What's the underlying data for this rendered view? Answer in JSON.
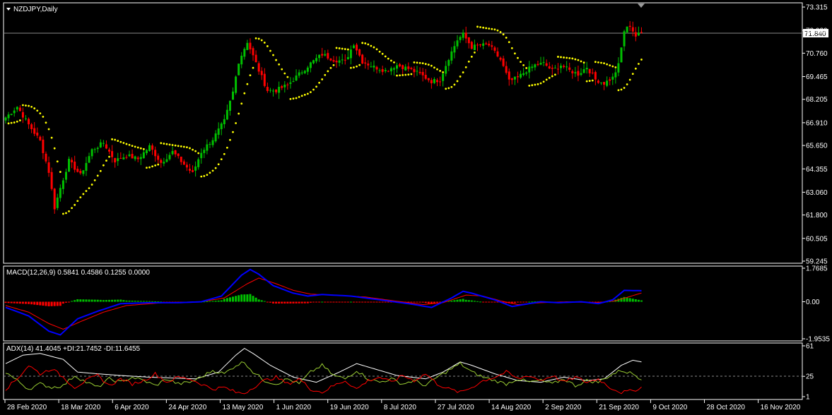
{
  "symbol_title": "NZDJPY,Daily",
  "price_label": "71.840",
  "macd_title": "MACD(12,26,9) 0.5841 0.4586 0.1255 0.0000",
  "adx_title": "ADX(14) 41.4045 +DI:21.7452 -DI:11.6455",
  "colors": {
    "background": "#000000",
    "bull": "#00c000",
    "bear": "#ff0000",
    "sar": "#ffff00",
    "macd_line": "#0000ff",
    "signal_line": "#ff0000",
    "adx_line": "#ffffff",
    "plus_di": "#9acd32",
    "minus_di": "#ff0000"
  },
  "chart_data": [
    {
      "type": "candlestick",
      "panel": "price",
      "y_ticks": [
        "73.315",
        "72.020",
        "70.760",
        "69.465",
        "68.205",
        "66.910",
        "65.650",
        "64.355",
        "63.060",
        "61.800",
        "60.505",
        "59.245"
      ],
      "ylim": [
        59.245,
        73.315
      ],
      "current_price": 71.84,
      "indicators": [
        "Parabolic SAR"
      ],
      "close_keypoints": [
        [
          0,
          67.2
        ],
        [
          4,
          67.8
        ],
        [
          8,
          66.8
        ],
        [
          12,
          65.9
        ],
        [
          15,
          64.2
        ],
        [
          17,
          62.2
        ],
        [
          19,
          63.3
        ],
        [
          22,
          64.8
        ],
        [
          26,
          64.0
        ],
        [
          30,
          65.4
        ],
        [
          34,
          65.8
        ],
        [
          38,
          64.8
        ],
        [
          42,
          65.1
        ],
        [
          46,
          64.9
        ],
        [
          50,
          65.6
        ],
        [
          54,
          64.7
        ],
        [
          58,
          65.3
        ],
        [
          62,
          64.6
        ],
        [
          65,
          64.1
        ],
        [
          68,
          65.3
        ],
        [
          72,
          66.0
        ],
        [
          76,
          67.0
        ],
        [
          79,
          68.6
        ],
        [
          81,
          70.3
        ],
        [
          84,
          71.4
        ],
        [
          86,
          70.6
        ],
        [
          88,
          69.8
        ],
        [
          91,
          68.7
        ],
        [
          94,
          68.7
        ],
        [
          98,
          69.0
        ],
        [
          102,
          69.6
        ],
        [
          106,
          70.2
        ],
        [
          110,
          70.7
        ],
        [
          114,
          70.4
        ],
        [
          118,
          70.3
        ],
        [
          121,
          71.3
        ],
        [
          124,
          70.3
        ],
        [
          128,
          70.0
        ],
        [
          132,
          69.8
        ],
        [
          136,
          70.1
        ],
        [
          140,
          69.9
        ],
        [
          144,
          69.6
        ],
        [
          148,
          69.2
        ],
        [
          151,
          69.3
        ],
        [
          154,
          70.5
        ],
        [
          157,
          71.5
        ],
        [
          159,
          71.8
        ],
        [
          162,
          71.1
        ],
        [
          165,
          71.2
        ],
        [
          168,
          71.2
        ],
        [
          172,
          70.4
        ],
        [
          175,
          69.2
        ],
        [
          178,
          69.4
        ],
        [
          181,
          69.8
        ],
        [
          184,
          70.1
        ],
        [
          187,
          70.2
        ],
        [
          190,
          69.8
        ],
        [
          193,
          70.1
        ],
        [
          196,
          69.8
        ],
        [
          199,
          69.6
        ],
        [
          202,
          70.0
        ],
        [
          205,
          69.3
        ],
        [
          208,
          69.1
        ],
        [
          211,
          69.4
        ],
        [
          213,
          70.1
        ],
        [
          215,
          72.0
        ],
        [
          217,
          72.3
        ],
        [
          219,
          71.7
        ],
        [
          221,
          71.9
        ]
      ],
      "x_ticks": [
        "28 Feb 2020",
        "18 Mar 2020",
        "6 Apr 2020",
        "24 Apr 2020",
        "13 May 2020",
        "1 Jun 2020",
        "19 Jun 2020",
        "8 Jul 2020",
        "27 Jul 2020",
        "14 Aug 2020",
        "2 Sep 2020",
        "21 Sep 2020",
        "9 Oct 2020",
        "28 Oct 2020",
        "16 Nov 2020"
      ]
    },
    {
      "type": "line+histogram",
      "panel": "macd",
      "y_ticks": [
        "1.7685",
        "0.00",
        "-1.9535"
      ],
      "ylim": [
        -1.9535,
        1.7685
      ],
      "series": [
        {
          "name": "MACD",
          "keypoints": [
            [
              0,
              -0.3
            ],
            [
              8,
              -0.75
            ],
            [
              15,
              -1.55
            ],
            [
              19,
              -1.75
            ],
            [
              25,
              -0.9
            ],
            [
              32,
              -0.5
            ],
            [
              40,
              -0.1
            ],
            [
              50,
              -0.05
            ],
            [
              60,
              -0.05
            ],
            [
              68,
              0.0
            ],
            [
              75,
              0.3
            ],
            [
              82,
              1.4
            ],
            [
              85,
              1.7
            ],
            [
              88,
              1.45
            ],
            [
              93,
              0.85
            ],
            [
              100,
              0.45
            ],
            [
              105,
              0.3
            ],
            [
              110,
              0.38
            ],
            [
              120,
              0.3
            ],
            [
              130,
              0.1
            ],
            [
              140,
              -0.1
            ],
            [
              148,
              -0.3
            ],
            [
              155,
              0.2
            ],
            [
              159,
              0.55
            ],
            [
              162,
              0.45
            ],
            [
              170,
              0.1
            ],
            [
              176,
              -0.25
            ],
            [
              180,
              -0.15
            ],
            [
              186,
              0.0
            ],
            [
              192,
              -0.05
            ],
            [
              200,
              0.0
            ],
            [
              206,
              -0.1
            ],
            [
              211,
              0.1
            ],
            [
              215,
              0.6
            ],
            [
              221,
              0.58
            ]
          ]
        },
        {
          "name": "Signal",
          "keypoints": [
            [
              0,
              -0.2
            ],
            [
              8,
              -0.55
            ],
            [
              15,
              -1.15
            ],
            [
              20,
              -1.45
            ],
            [
              26,
              -1.05
            ],
            [
              34,
              -0.55
            ],
            [
              42,
              -0.2
            ],
            [
              55,
              -0.05
            ],
            [
              68,
              0.0
            ],
            [
              76,
              0.2
            ],
            [
              84,
              0.95
            ],
            [
              88,
              1.25
            ],
            [
              94,
              0.95
            ],
            [
              100,
              0.6
            ],
            [
              106,
              0.4
            ],
            [
              115,
              0.35
            ],
            [
              125,
              0.25
            ],
            [
              135,
              0.05
            ],
            [
              145,
              -0.15
            ],
            [
              152,
              -0.05
            ],
            [
              160,
              0.35
            ],
            [
              166,
              0.3
            ],
            [
              172,
              0.05
            ],
            [
              178,
              -0.15
            ],
            [
              186,
              -0.05
            ],
            [
              195,
              0.0
            ],
            [
              205,
              -0.05
            ],
            [
              212,
              0.05
            ],
            [
              221,
              0.46
            ]
          ]
        }
      ]
    },
    {
      "type": "line",
      "panel": "adx",
      "y_ticks": [
        "61",
        "25",
        "1"
      ],
      "ylim": [
        1,
        61
      ],
      "series": [
        {
          "name": "ADX",
          "keypoints": [
            [
              0,
              40
            ],
            [
              6,
              50
            ],
            [
              12,
              52
            ],
            [
              20,
              45
            ],
            [
              25,
              30
            ],
            [
              32,
              28
            ],
            [
              40,
              26
            ],
            [
              50,
              24
            ],
            [
              58,
              23
            ],
            [
              66,
              22
            ],
            [
              74,
              30
            ],
            [
              80,
              50
            ],
            [
              83,
              58
            ],
            [
              86,
              52
            ],
            [
              92,
              38
            ],
            [
              100,
              24
            ],
            [
              108,
              18
            ],
            [
              116,
              30
            ],
            [
              122,
              40
            ],
            [
              128,
              34
            ],
            [
              136,
              26
            ],
            [
              146,
              22
            ],
            [
              152,
              30
            ],
            [
              158,
              42
            ],
            [
              162,
              38
            ],
            [
              170,
              28
            ],
            [
              178,
              20
            ],
            [
              186,
              18
            ],
            [
              194,
              24
            ],
            [
              202,
              20
            ],
            [
              208,
              22
            ],
            [
              214,
              38
            ],
            [
              218,
              44
            ],
            [
              221,
              42
            ]
          ]
        },
        {
          "name": "+DI",
          "keypoints": [
            [
              0,
              30
            ],
            [
              4,
              20
            ],
            [
              8,
              10
            ],
            [
              12,
              16
            ],
            [
              16,
              12
            ],
            [
              20,
              14
            ],
            [
              24,
              26
            ],
            [
              28,
              18
            ],
            [
              32,
              12
            ],
            [
              36,
              22
            ],
            [
              40,
              18
            ],
            [
              44,
              24
            ],
            [
              48,
              20
            ],
            [
              52,
              14
            ],
            [
              56,
              22
            ],
            [
              60,
              16
            ],
            [
              64,
              18
            ],
            [
              68,
              24
            ],
            [
              72,
              32
            ],
            [
              76,
              28
            ],
            [
              80,
              38
            ],
            [
              83,
              42
            ],
            [
              86,
              30
            ],
            [
              90,
              20
            ],
            [
              94,
              16
            ],
            [
              98,
              22
            ],
            [
              102,
              16
            ],
            [
              106,
              30
            ],
            [
              110,
              38
            ],
            [
              114,
              26
            ],
            [
              118,
              22
            ],
            [
              122,
              32
            ],
            [
              126,
              22
            ],
            [
              130,
              18
            ],
            [
              134,
              22
            ],
            [
              138,
              16
            ],
            [
              142,
              20
            ],
            [
              146,
              14
            ],
            [
              150,
              24
            ],
            [
              154,
              32
            ],
            [
              158,
              40
            ],
            [
              162,
              30
            ],
            [
              166,
              24
            ],
            [
              170,
              20
            ],
            [
              174,
              16
            ],
            [
              178,
              22
            ],
            [
              182,
              18
            ],
            [
              186,
              20
            ],
            [
              190,
              16
            ],
            [
              194,
              22
            ],
            [
              198,
              14
            ],
            [
              202,
              20
            ],
            [
              206,
              18
            ],
            [
              210,
              26
            ],
            [
              214,
              32
            ],
            [
              218,
              28
            ],
            [
              221,
              22
            ]
          ]
        },
        {
          "name": "-DI",
          "keypoints": [
            [
              0,
              10
            ],
            [
              4,
              22
            ],
            [
              8,
              38
            ],
            [
              12,
              28
            ],
            [
              16,
              34
            ],
            [
              20,
              24
            ],
            [
              24,
              12
            ],
            [
              28,
              20
            ],
            [
              32,
              26
            ],
            [
              36,
              14
            ],
            [
              40,
              22
            ],
            [
              44,
              16
            ],
            [
              48,
              20
            ],
            [
              52,
              28
            ],
            [
              56,
              18
            ],
            [
              60,
              24
            ],
            [
              64,
              22
            ],
            [
              68,
              16
            ],
            [
              72,
              10
            ],
            [
              76,
              12
            ],
            [
              80,
              6
            ],
            [
              83,
              5
            ],
            [
              86,
              12
            ],
            [
              90,
              20
            ],
            [
              94,
              24
            ],
            [
              98,
              16
            ],
            [
              102,
              22
            ],
            [
              106,
              10
            ],
            [
              110,
              6
            ],
            [
              114,
              14
            ],
            [
              118,
              20
            ],
            [
              122,
              10
            ],
            [
              126,
              20
            ],
            [
              130,
              24
            ],
            [
              134,
              18
            ],
            [
              138,
              26
            ],
            [
              142,
              20
            ],
            [
              146,
              28
            ],
            [
              150,
              16
            ],
            [
              154,
              10
            ],
            [
              158,
              6
            ],
            [
              162,
              12
            ],
            [
              166,
              20
            ],
            [
              170,
              24
            ],
            [
              174,
              30
            ],
            [
              178,
              22
            ],
            [
              182,
              26
            ],
            [
              186,
              20
            ],
            [
              190,
              26
            ],
            [
              194,
              18
            ],
            [
              198,
              24
            ],
            [
              202,
              18
            ],
            [
              206,
              22
            ],
            [
              210,
              12
            ],
            [
              214,
              6
            ],
            [
              218,
              8
            ],
            [
              221,
              12
            ]
          ]
        }
      ]
    }
  ]
}
